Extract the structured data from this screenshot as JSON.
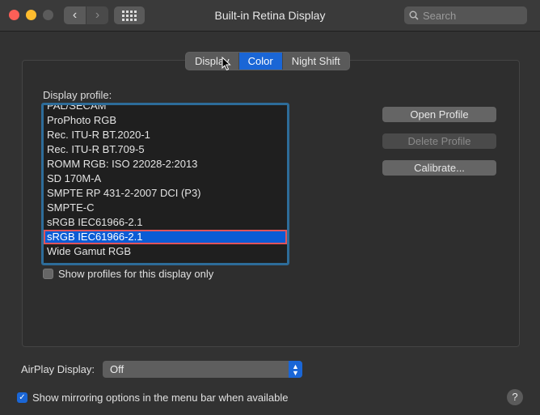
{
  "window": {
    "title": "Built-in Retina Display",
    "nav_back": "‹",
    "nav_forward": "›"
  },
  "search": {
    "placeholder": "Search"
  },
  "tabs": [
    {
      "label": "Display",
      "active": false
    },
    {
      "label": "Color",
      "active": true
    },
    {
      "label": "Night Shift",
      "active": false
    }
  ],
  "profile": {
    "label": "Display profile:",
    "items": [
      "PAL/SECAM",
      "ProPhoto RGB",
      "Rec. ITU-R BT.2020-1",
      "Rec. ITU-R BT.709-5",
      "ROMM RGB: ISO 22028-2:2013",
      "SD 170M-A",
      "SMPTE RP 431-2-2007 DCI (P3)",
      "SMPTE-C",
      "sRGB IEC61966-2.1",
      "sRGB IEC61966-2.1",
      "Wide Gamut RGB"
    ],
    "selected_index": 9
  },
  "buttons": {
    "open_profile": "Open Profile",
    "delete_profile": "Delete Profile",
    "calibrate": "Calibrate..."
  },
  "show_profiles": {
    "label": "Show profiles for this display only",
    "checked": false
  },
  "airplay": {
    "label": "AirPlay Display:",
    "value": "Off"
  },
  "mirroring": {
    "label": "Show mirroring options in the menu bar when available",
    "checked": true
  },
  "help": {
    "label": "?"
  },
  "colors": {
    "accent": "#1a66d6",
    "selection_outline": "#e0545a",
    "list_border": "#2d6c99"
  }
}
